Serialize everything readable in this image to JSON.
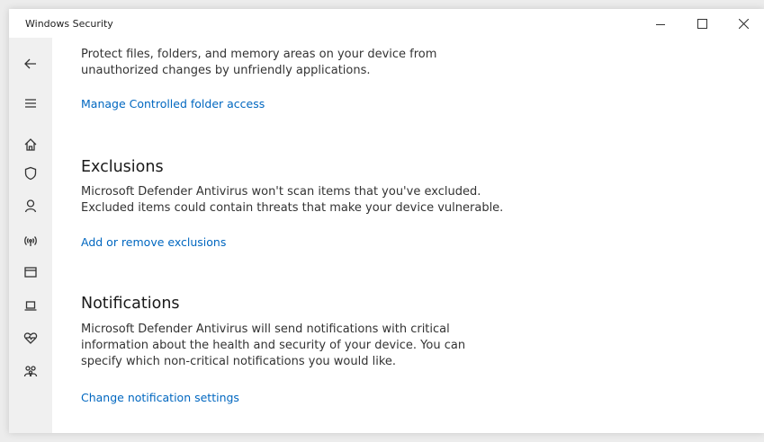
{
  "window": {
    "title": "Windows Security"
  },
  "nav": {
    "items": [
      {
        "icon": "back-arrow-icon"
      },
      {
        "icon": "hamburger-menu-icon"
      },
      {
        "icon": "home-icon"
      },
      {
        "icon": "shield-icon"
      },
      {
        "icon": "person-icon"
      },
      {
        "icon": "wireless-icon"
      },
      {
        "icon": "app-browser-icon"
      },
      {
        "icon": "laptop-icon"
      },
      {
        "icon": "heart-icon"
      },
      {
        "icon": "family-icon"
      }
    ]
  },
  "sections": {
    "controlled_folder": {
      "description": "Protect files, folders, and memory areas on your device from unauthorized changes by unfriendly applications.",
      "link": "Manage Controlled folder access"
    },
    "exclusions": {
      "heading": "Exclusions",
      "description": "Microsoft Defender Antivirus won't scan items that you've excluded. Excluded items could contain threats that make your device vulnerable.",
      "link": "Add or remove exclusions"
    },
    "notifications": {
      "heading": "Notifications",
      "description": "Microsoft Defender Antivirus will send notifications with critical information about the health and security of your device. You can specify which non-critical notifications you would like.",
      "link": "Change notification settings"
    }
  },
  "colors": {
    "accent_link": "#0067c0",
    "nav_background": "#f0f0f0"
  }
}
